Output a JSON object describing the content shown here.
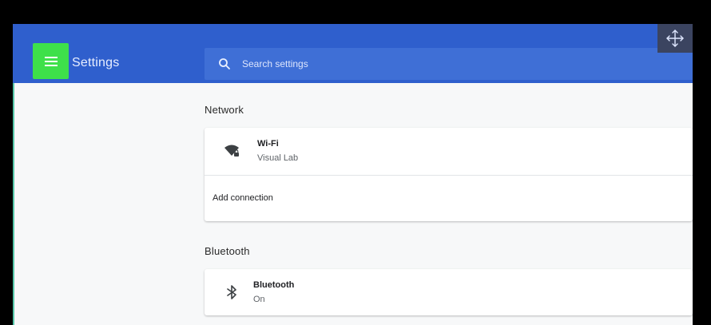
{
  "header": {
    "title": "Settings",
    "menu_icon": "hamburger-menu-icon",
    "move_icon": "move-arrows-icon",
    "accent_color": "#2f5fcd",
    "highlight_color": "#3ee04a"
  },
  "search": {
    "placeholder": "Search settings",
    "icon": "search-icon"
  },
  "sections": {
    "network": {
      "title": "Network",
      "wifi": {
        "label": "Wi-Fi",
        "status": "Visual Lab",
        "icon": "wifi-locked-icon"
      },
      "add_connection": "Add connection"
    },
    "bluetooth": {
      "title": "Bluetooth",
      "item": {
        "label": "Bluetooth",
        "status": "On",
        "icon": "bluetooth-icon"
      }
    }
  }
}
